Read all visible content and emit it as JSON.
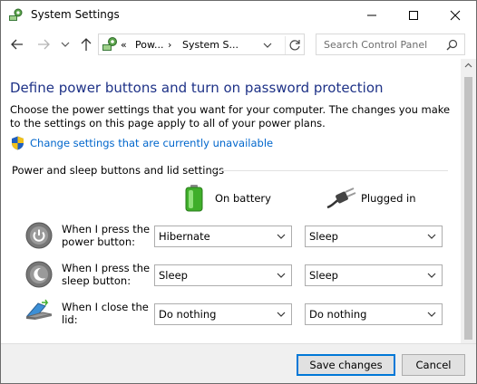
{
  "window": {
    "title": "System Settings",
    "buttons": {
      "minimize": "minimize",
      "maximize": "maximize",
      "close": "close"
    }
  },
  "address_bar": {
    "overflow": "«",
    "crumbs": [
      "Pow...",
      "System S..."
    ],
    "separator": "›",
    "search_placeholder": "Search Control Panel"
  },
  "page": {
    "title": "Define power buttons and turn on password protection",
    "description": "Choose the power settings that you want for your computer. The changes you make to the settings on this page apply to all of your power plans.",
    "change_link": "Change settings that are currently unavailable",
    "section_title": "Power and sleep buttons and lid settings",
    "columns": {
      "battery": "On battery",
      "plugged": "Plugged in"
    },
    "rows": [
      {
        "label": "When I press the power button:",
        "battery": "Hibernate",
        "plugged": "Sleep",
        "icon": "power-button-icon"
      },
      {
        "label": "When I press the sleep button:",
        "battery": "Sleep",
        "plugged": "Sleep",
        "icon": "sleep-button-icon"
      },
      {
        "label": "When I close the lid:",
        "battery": "Do nothing",
        "plugged": "Do nothing",
        "icon": "laptop-lid-icon"
      }
    ]
  },
  "footer": {
    "save": "Save changes",
    "cancel": "Cancel"
  },
  "colors": {
    "title_blue": "#1e3287",
    "link_blue": "#0066cc",
    "accent": "#0078d7"
  }
}
